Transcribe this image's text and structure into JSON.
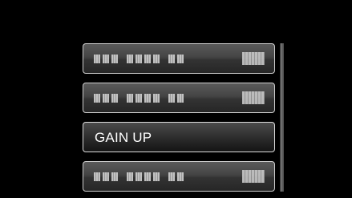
{
  "menu": {
    "items": [
      {
        "label": "",
        "state": "obscured"
      },
      {
        "label": "",
        "state": "obscured"
      },
      {
        "label": "GAIN UP",
        "state": "selected"
      },
      {
        "label": "",
        "state": "obscured"
      }
    ]
  },
  "scrollbar": {
    "visible_fraction": 1.0
  },
  "colors": {
    "background": "#000000",
    "item_border": "#cfcfcf",
    "text": "#ffffff"
  }
}
